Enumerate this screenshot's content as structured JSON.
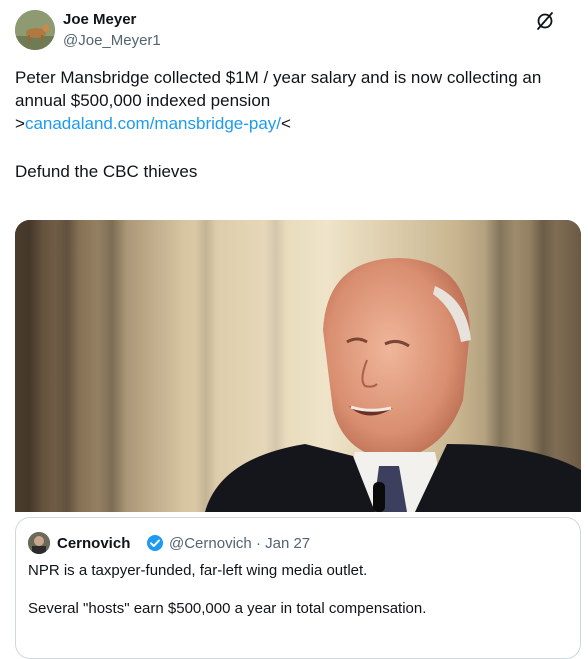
{
  "author": {
    "name": "Joe Meyer",
    "handle": "@Joe_Meyer1"
  },
  "tweet": {
    "line1": "Peter Mansbridge collected $1M / year salary and is now collecting an annual $500,000 indexed pension",
    "link_prefix": ">",
    "link_text": "canadaland.com/mansbridge-pay/",
    "link_suffix": "<",
    "line3": "Defund the CBC thieves"
  },
  "quote": {
    "name": "Cernovich",
    "handle": "@Cernovich",
    "separator": "·",
    "date": "Jan 27",
    "text1": "NPR is a taxpyer-funded, far-left wing media outlet.",
    "text2": "Several \"hosts\" earn $500,000 a year in total compensation."
  },
  "colors": {
    "link": "#1d9bf0",
    "secondary_text": "#536471",
    "verified_badge": "#1d9bf0"
  },
  "icons": {
    "grok": "grok-icon",
    "verified": "verified-badge-icon"
  }
}
